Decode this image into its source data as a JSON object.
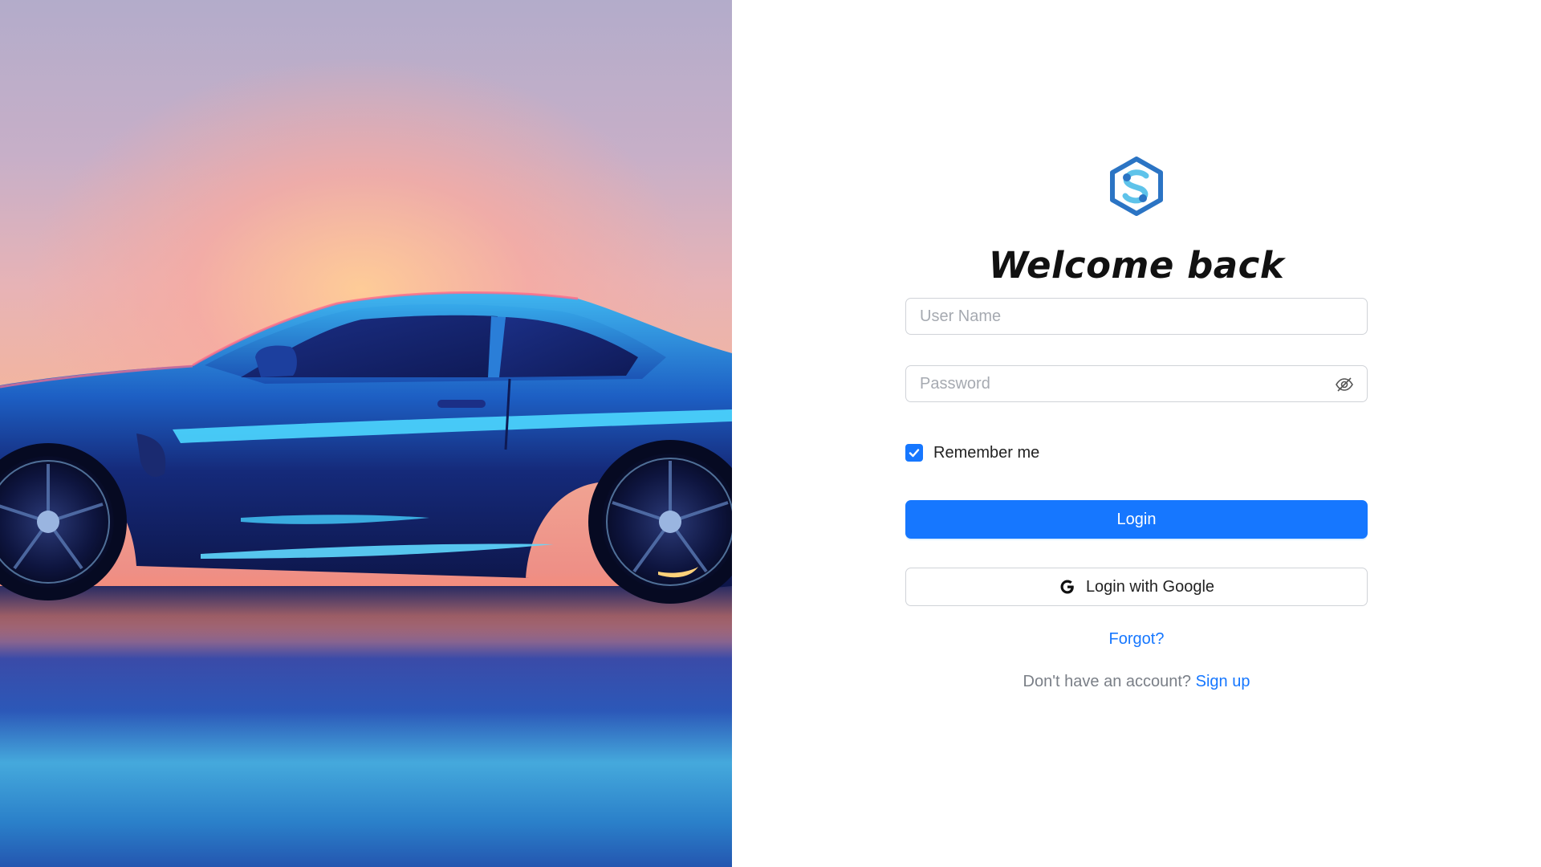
{
  "login": {
    "title": "Welcome back",
    "username_placeholder": "User Name",
    "password_placeholder": "Password",
    "remember_label": "Remember me",
    "remember_checked": true,
    "login_button": "Login",
    "google_button": "Login with Google",
    "forgot_link": "Forgot?",
    "signup_prompt": "Don't have an account?",
    "signup_link": "Sign up"
  },
  "icons": {
    "logo": "hexagon-s-logo-icon",
    "password_toggle": "eye-slash-icon",
    "checkbox": "check-icon",
    "google": "google-g-icon"
  },
  "colors": {
    "primary": "#1677ff",
    "logo_dark": "#2b74c4",
    "logo_light": "#5ec3ea",
    "text": "#111111",
    "muted": "#7a7f87",
    "border": "#d0d3d8"
  },
  "hero": {
    "image": "blue sports car at sunset"
  }
}
